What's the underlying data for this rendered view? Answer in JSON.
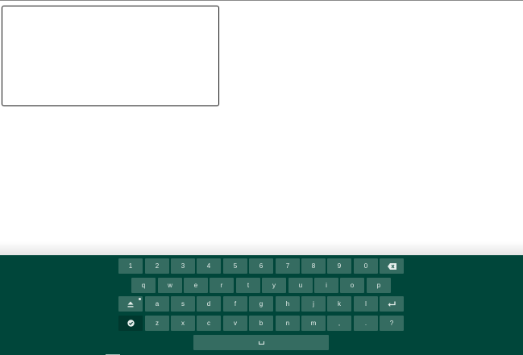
{
  "keyboard": {
    "row1": [
      "1",
      "2",
      "3",
      "4",
      "5",
      "6",
      "7",
      "8",
      "9",
      "0"
    ],
    "row2": [
      "q",
      "w",
      "e",
      "r",
      "t",
      "y",
      "u",
      "i",
      "o",
      "p"
    ],
    "row3": [
      "a",
      "s",
      "d",
      "f",
      "g",
      "h",
      "j",
      "k",
      "l"
    ],
    "row4": [
      "z",
      "x",
      "c",
      "v",
      "b",
      "n",
      "m",
      ",",
      ".",
      "?"
    ],
    "icons": {
      "backspace": "backspace-icon",
      "enter": "enter-icon",
      "shift": "shift-icon",
      "done": "checkmark-circle-icon",
      "space": "space-icon"
    },
    "colors": {
      "background": "#00463a",
      "key": "#356c61",
      "key_dark": "#00382e",
      "key_text": "#e6efec"
    }
  },
  "text_area": {
    "value": ""
  }
}
